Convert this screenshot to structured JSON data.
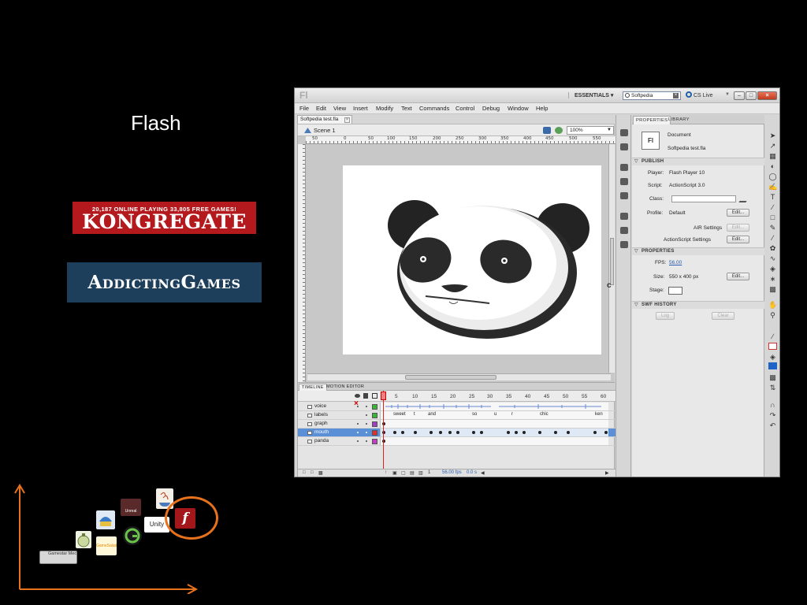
{
  "slide": {
    "title": "Flash",
    "kongregate": {
      "tagline": "20,187 ONLINE PLAYING 33,805 FREE GAMES!",
      "name": "KONGREGATE"
    },
    "addicting_games": "AddictingGames"
  },
  "window": {
    "app_logo": "Fl",
    "workspace": "ESSENTIALS",
    "search_value": "Softpedia",
    "cs_live": "CS Live",
    "menu": [
      "File",
      "Edit",
      "View",
      "Insert",
      "Modify",
      "Text",
      "Commands",
      "Control",
      "Debug",
      "Window",
      "Help"
    ],
    "doc_tab": "Softpedia test.fla",
    "scene": "Scene 1",
    "zoom": "100%",
    "ruler_ticks": [
      "50",
      "0",
      "50",
      "100",
      "150",
      "200",
      "250",
      "300",
      "350",
      "400",
      "450",
      "500",
      "550"
    ]
  },
  "properties": {
    "tabs": [
      "PROPERTIES",
      "LIBRARY"
    ],
    "doc_icon": "Fl",
    "doc_type": "Document",
    "doc_name": "Softpedia test.fla",
    "publish_header": "PUBLISH",
    "player_label": "Player:",
    "player_value": "Flash Player 10",
    "script_label": "Script:",
    "script_value": "ActionScript 3.0",
    "class_label": "Class:",
    "profile_label": "Profile:",
    "profile_value": "Default",
    "edit_label": "Edit...",
    "air_settings": "AIR Settings",
    "as_settings": "ActionScript Settings",
    "properties_header": "PROPERTIES",
    "fps_label": "FPS:",
    "fps_value": "56.00",
    "size_label": "Size:",
    "size_value": "550 x 400 px",
    "stage_label": "Stage:",
    "swf_header": "SWF HISTORY",
    "log_label": "Log",
    "clear_label": "Clear",
    "stage_color": "#FFFFFF"
  },
  "timeline": {
    "tabs": [
      "TIMELINE",
      "MOTION EDITOR"
    ],
    "frame_numbers": [
      "1",
      "5",
      "10",
      "15",
      "20",
      "25",
      "30",
      "35",
      "40",
      "45",
      "50",
      "55",
      "60"
    ],
    "layers": [
      {
        "name": "voice",
        "color": "#3ab53a",
        "labels": []
      },
      {
        "name": "labels",
        "color": "#3ab53a",
        "labels": [
          "sweet",
          "t",
          "and",
          "so",
          "u",
          "r",
          "chic",
          "ken"
        ]
      },
      {
        "name": "graph",
        "color": "#a040c0",
        "labels": []
      },
      {
        "name": "mouth",
        "color": "#e03030",
        "labels": [],
        "selected": true
      },
      {
        "name": "panda",
        "color": "#c040c0",
        "labels": []
      }
    ],
    "footer_frame": "1",
    "footer_fps": "56.00 fps",
    "footer_time": "0.0 s"
  },
  "chart": {
    "logos": [
      "Unreal",
      "Unity",
      "GameSalad",
      "Gamestar Mechanic"
    ],
    "highlight_color": "#e8721c",
    "axis_color": "#e8721c"
  }
}
